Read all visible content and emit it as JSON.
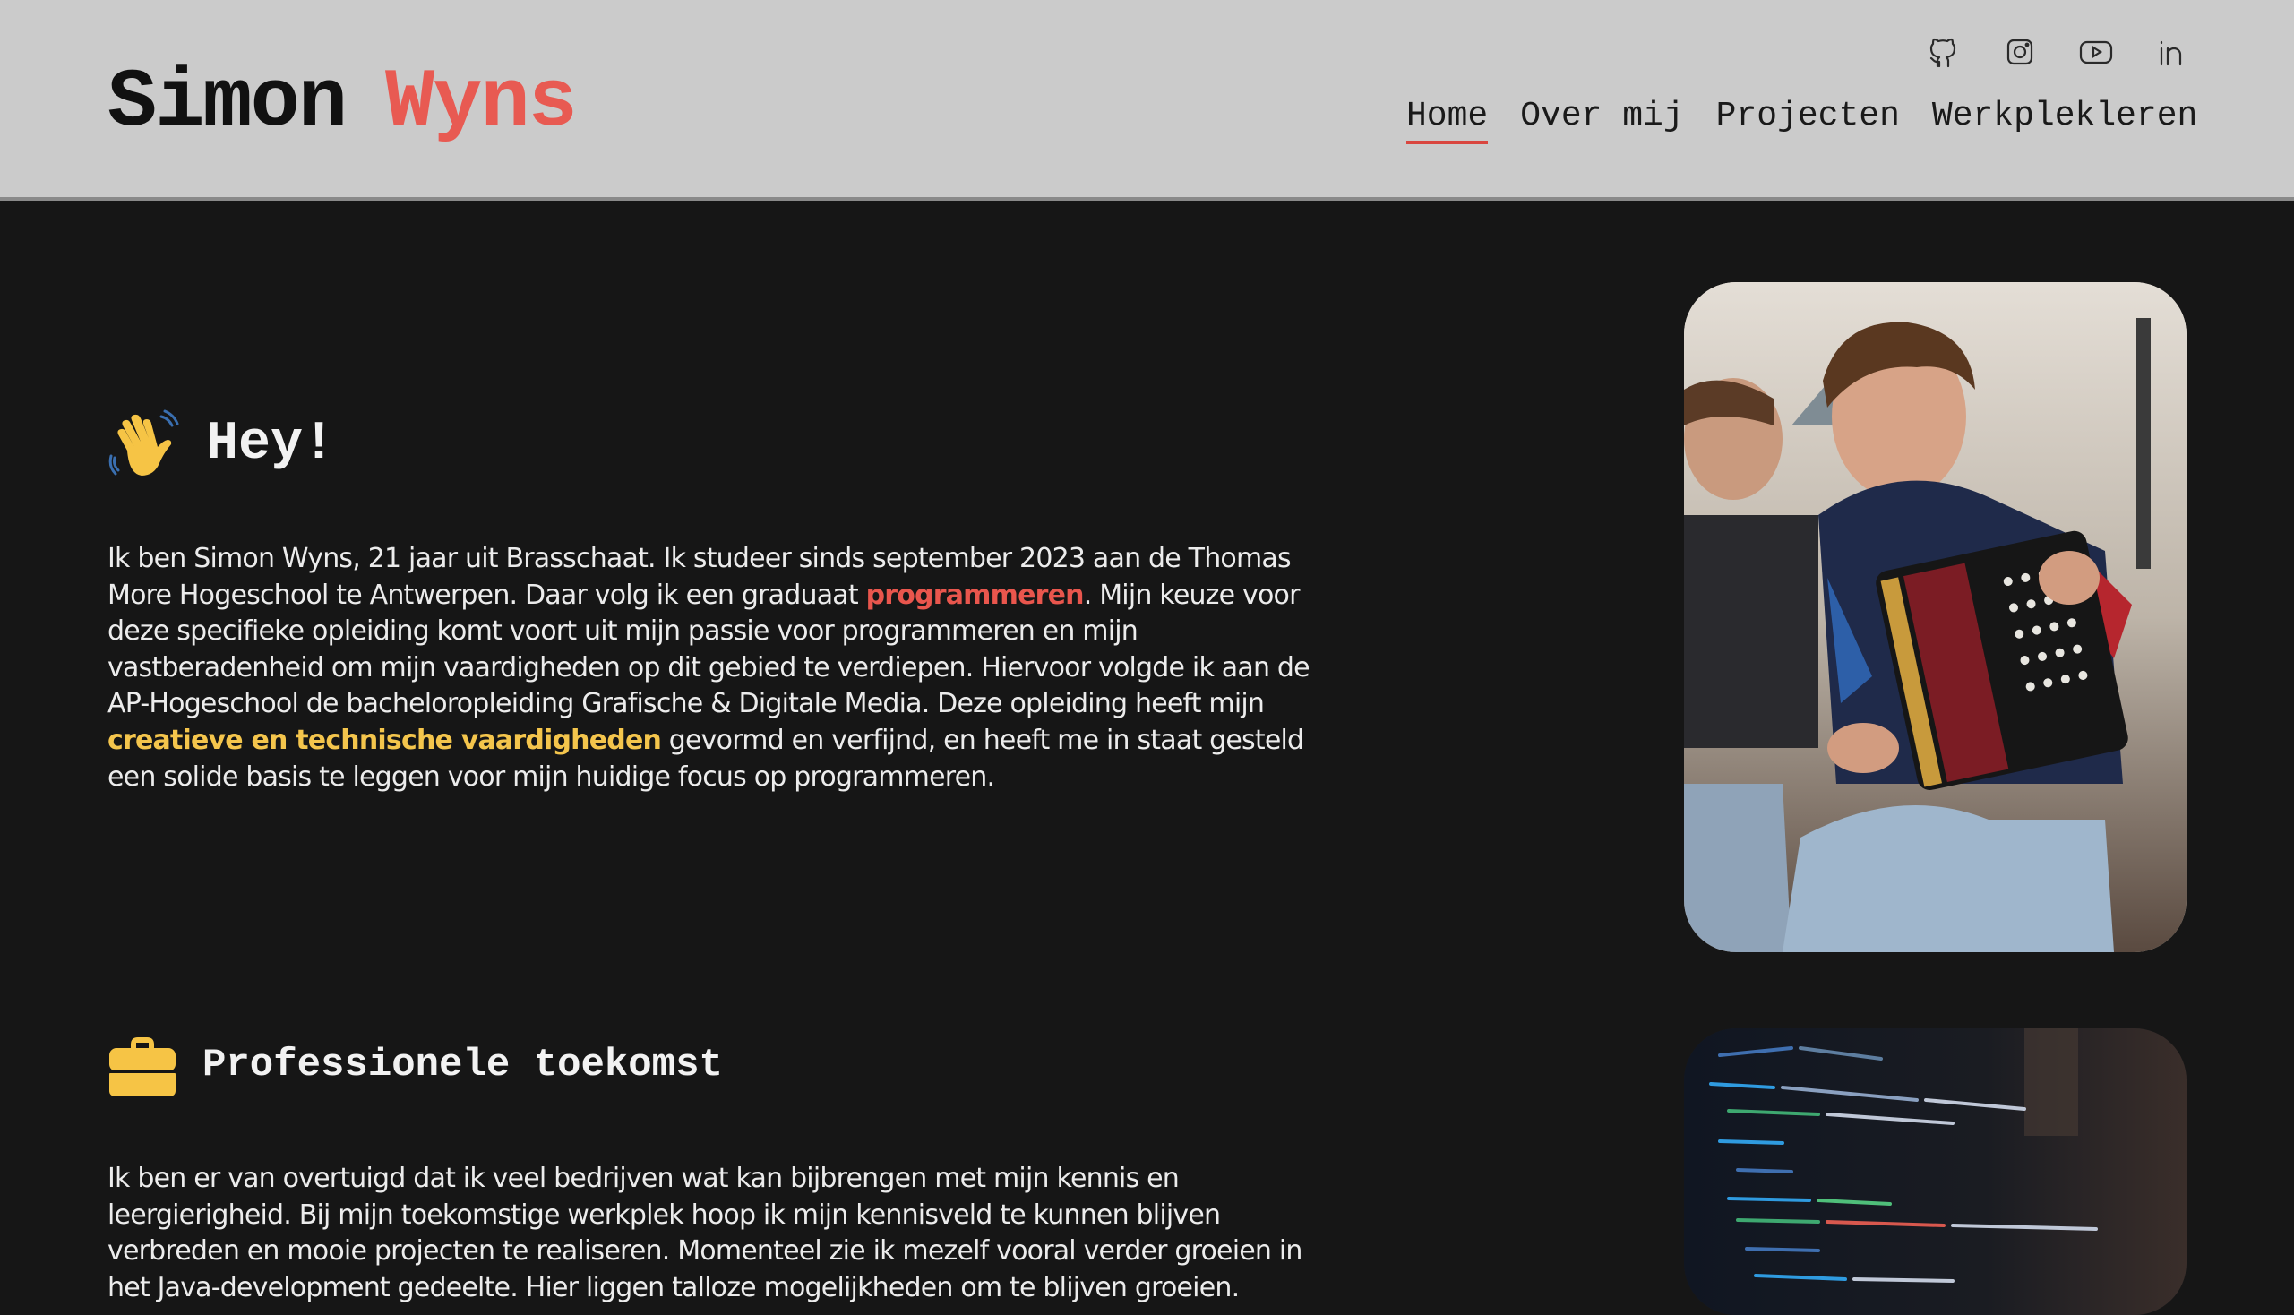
{
  "header": {
    "first_name": "Simon",
    "last_name": "Wyns",
    "socials": [
      {
        "icon": "github-icon"
      },
      {
        "icon": "instagram-icon"
      },
      {
        "icon": "youtube-icon"
      },
      {
        "icon": "linkedin-icon"
      }
    ],
    "nav": [
      {
        "label": "Home",
        "active": true
      },
      {
        "label": "Over mij"
      },
      {
        "label": "Projecten"
      },
      {
        "label": "Werkplekleren"
      }
    ]
  },
  "intro": {
    "title": "Hey!",
    "icon": "waving-hand-icon",
    "text_1": "Ik ben Simon Wyns, 21 jaar uit Brasschaat. Ik studeer sinds september 2023 aan de Thomas More Hogeschool te Antwerpen. Daar volg ik een graduaat ",
    "highlight_1": "programmeren",
    "text_2": ". Mijn keuze voor deze specifieke opleiding komt voort uit mijn passie voor programmeren en mijn vastberadenheid om mijn vaardigheden op dit gebied te verdiepen. Hiervoor volgde ik aan de AP-Hogeschool de bacheloropleiding Grafische & Digitale Media. Deze opleiding heeft mijn ",
    "highlight_2": "creatieve en technische vaardigheden",
    "text_3": " gevormd en verfijnd, en heeft me in staat gesteld een solide basis te leggen voor mijn huidige focus op programmeren."
  },
  "future": {
    "title": "Professionele toekomst",
    "icon": "briefcase-icon",
    "text": "Ik ben er van overtuigd dat ik veel bedrijven wat kan bijbrengen met mijn kennis en leergierigheid. Bij mijn toekomstige werkplek hoop ik mijn kennisveld te kunnen blijven verbreden en mooie projecten te realiseren. Momenteel zie ik mezelf vooral verder groeien in het Java-development gedeelte. Hier liggen talloze mogelijkheden om te blijven groeien."
  },
  "colors": {
    "accent_red": "#e9564d",
    "accent_yellow": "#f4c54c",
    "background": "#161616",
    "header_bg": "#cbcbcb"
  }
}
